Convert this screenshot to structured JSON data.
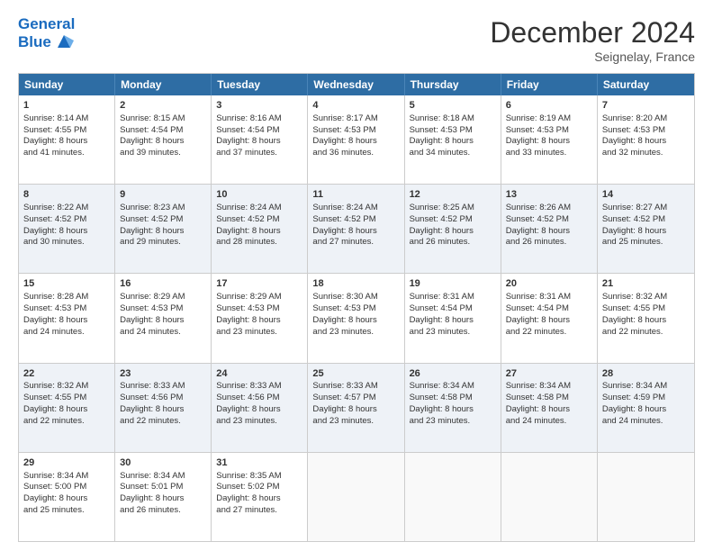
{
  "logo": {
    "line1": "General",
    "line2": "Blue"
  },
  "title": "December 2024",
  "subtitle": "Seignelay, France",
  "days": [
    "Sunday",
    "Monday",
    "Tuesday",
    "Wednesday",
    "Thursday",
    "Friday",
    "Saturday"
  ],
  "rows": [
    [
      {
        "num": "1",
        "lines": [
          "Sunrise: 8:14 AM",
          "Sunset: 4:55 PM",
          "Daylight: 8 hours",
          "and 41 minutes."
        ]
      },
      {
        "num": "2",
        "lines": [
          "Sunrise: 8:15 AM",
          "Sunset: 4:54 PM",
          "Daylight: 8 hours",
          "and 39 minutes."
        ]
      },
      {
        "num": "3",
        "lines": [
          "Sunrise: 8:16 AM",
          "Sunset: 4:54 PM",
          "Daylight: 8 hours",
          "and 37 minutes."
        ]
      },
      {
        "num": "4",
        "lines": [
          "Sunrise: 8:17 AM",
          "Sunset: 4:53 PM",
          "Daylight: 8 hours",
          "and 36 minutes."
        ]
      },
      {
        "num": "5",
        "lines": [
          "Sunrise: 8:18 AM",
          "Sunset: 4:53 PM",
          "Daylight: 8 hours",
          "and 34 minutes."
        ]
      },
      {
        "num": "6",
        "lines": [
          "Sunrise: 8:19 AM",
          "Sunset: 4:53 PM",
          "Daylight: 8 hours",
          "and 33 minutes."
        ]
      },
      {
        "num": "7",
        "lines": [
          "Sunrise: 8:20 AM",
          "Sunset: 4:53 PM",
          "Daylight: 8 hours",
          "and 32 minutes."
        ]
      }
    ],
    [
      {
        "num": "8",
        "lines": [
          "Sunrise: 8:22 AM",
          "Sunset: 4:52 PM",
          "Daylight: 8 hours",
          "and 30 minutes."
        ]
      },
      {
        "num": "9",
        "lines": [
          "Sunrise: 8:23 AM",
          "Sunset: 4:52 PM",
          "Daylight: 8 hours",
          "and 29 minutes."
        ]
      },
      {
        "num": "10",
        "lines": [
          "Sunrise: 8:24 AM",
          "Sunset: 4:52 PM",
          "Daylight: 8 hours",
          "and 28 minutes."
        ]
      },
      {
        "num": "11",
        "lines": [
          "Sunrise: 8:24 AM",
          "Sunset: 4:52 PM",
          "Daylight: 8 hours",
          "and 27 minutes."
        ]
      },
      {
        "num": "12",
        "lines": [
          "Sunrise: 8:25 AM",
          "Sunset: 4:52 PM",
          "Daylight: 8 hours",
          "and 26 minutes."
        ]
      },
      {
        "num": "13",
        "lines": [
          "Sunrise: 8:26 AM",
          "Sunset: 4:52 PM",
          "Daylight: 8 hours",
          "and 26 minutes."
        ]
      },
      {
        "num": "14",
        "lines": [
          "Sunrise: 8:27 AM",
          "Sunset: 4:52 PM",
          "Daylight: 8 hours",
          "and 25 minutes."
        ]
      }
    ],
    [
      {
        "num": "15",
        "lines": [
          "Sunrise: 8:28 AM",
          "Sunset: 4:53 PM",
          "Daylight: 8 hours",
          "and 24 minutes."
        ]
      },
      {
        "num": "16",
        "lines": [
          "Sunrise: 8:29 AM",
          "Sunset: 4:53 PM",
          "Daylight: 8 hours",
          "and 24 minutes."
        ]
      },
      {
        "num": "17",
        "lines": [
          "Sunrise: 8:29 AM",
          "Sunset: 4:53 PM",
          "Daylight: 8 hours",
          "and 23 minutes."
        ]
      },
      {
        "num": "18",
        "lines": [
          "Sunrise: 8:30 AM",
          "Sunset: 4:53 PM",
          "Daylight: 8 hours",
          "and 23 minutes."
        ]
      },
      {
        "num": "19",
        "lines": [
          "Sunrise: 8:31 AM",
          "Sunset: 4:54 PM",
          "Daylight: 8 hours",
          "and 23 minutes."
        ]
      },
      {
        "num": "20",
        "lines": [
          "Sunrise: 8:31 AM",
          "Sunset: 4:54 PM",
          "Daylight: 8 hours",
          "and 22 minutes."
        ]
      },
      {
        "num": "21",
        "lines": [
          "Sunrise: 8:32 AM",
          "Sunset: 4:55 PM",
          "Daylight: 8 hours",
          "and 22 minutes."
        ]
      }
    ],
    [
      {
        "num": "22",
        "lines": [
          "Sunrise: 8:32 AM",
          "Sunset: 4:55 PM",
          "Daylight: 8 hours",
          "and 22 minutes."
        ]
      },
      {
        "num": "23",
        "lines": [
          "Sunrise: 8:33 AM",
          "Sunset: 4:56 PM",
          "Daylight: 8 hours",
          "and 22 minutes."
        ]
      },
      {
        "num": "24",
        "lines": [
          "Sunrise: 8:33 AM",
          "Sunset: 4:56 PM",
          "Daylight: 8 hours",
          "and 23 minutes."
        ]
      },
      {
        "num": "25",
        "lines": [
          "Sunrise: 8:33 AM",
          "Sunset: 4:57 PM",
          "Daylight: 8 hours",
          "and 23 minutes."
        ]
      },
      {
        "num": "26",
        "lines": [
          "Sunrise: 8:34 AM",
          "Sunset: 4:58 PM",
          "Daylight: 8 hours",
          "and 23 minutes."
        ]
      },
      {
        "num": "27",
        "lines": [
          "Sunrise: 8:34 AM",
          "Sunset: 4:58 PM",
          "Daylight: 8 hours",
          "and 24 minutes."
        ]
      },
      {
        "num": "28",
        "lines": [
          "Sunrise: 8:34 AM",
          "Sunset: 4:59 PM",
          "Daylight: 8 hours",
          "and 24 minutes."
        ]
      }
    ],
    [
      {
        "num": "29",
        "lines": [
          "Sunrise: 8:34 AM",
          "Sunset: 5:00 PM",
          "Daylight: 8 hours",
          "and 25 minutes."
        ]
      },
      {
        "num": "30",
        "lines": [
          "Sunrise: 8:34 AM",
          "Sunset: 5:01 PM",
          "Daylight: 8 hours",
          "and 26 minutes."
        ]
      },
      {
        "num": "31",
        "lines": [
          "Sunrise: 8:35 AM",
          "Sunset: 5:02 PM",
          "Daylight: 8 hours",
          "and 27 minutes."
        ]
      },
      {
        "num": "",
        "lines": []
      },
      {
        "num": "",
        "lines": []
      },
      {
        "num": "",
        "lines": []
      },
      {
        "num": "",
        "lines": []
      }
    ]
  ]
}
